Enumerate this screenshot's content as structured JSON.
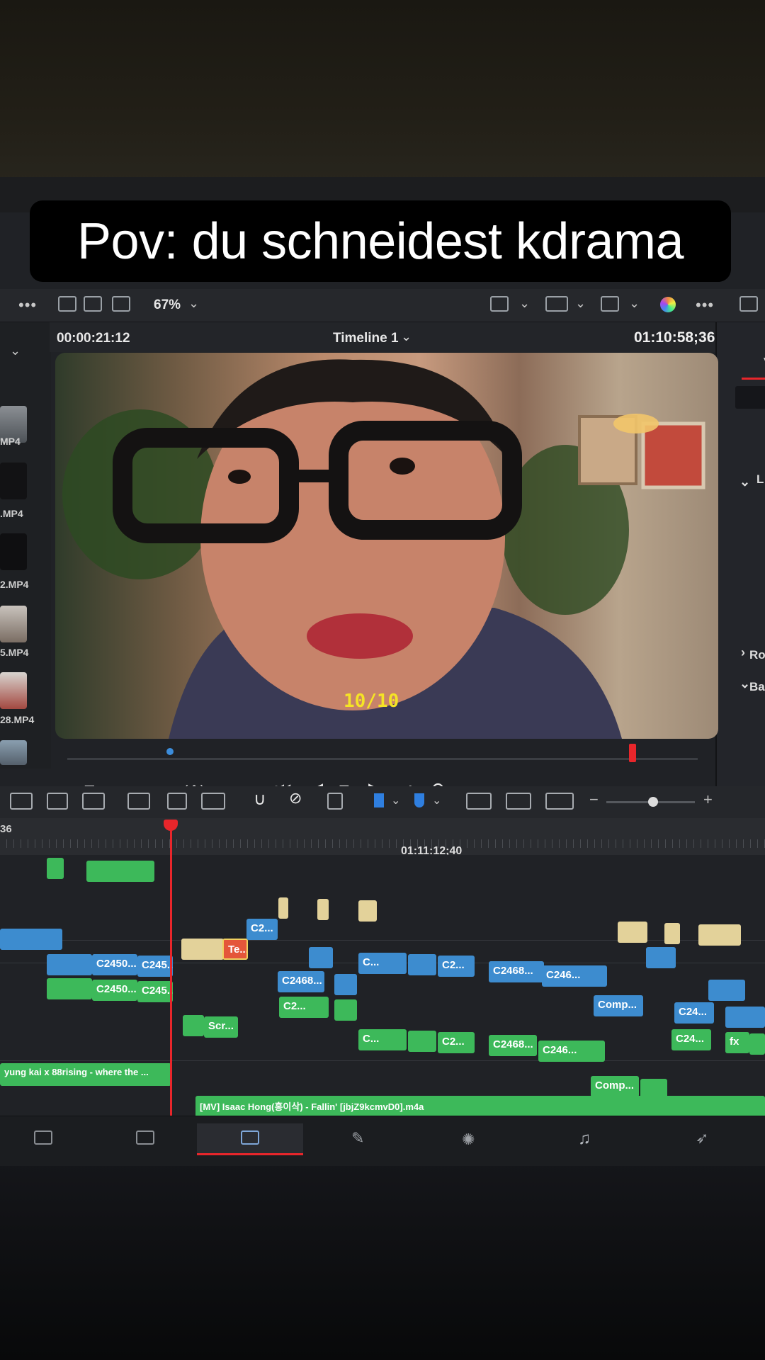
{
  "caption": "Pov: du schneidest kdrama",
  "toolbar": {
    "zoom_label": "67%",
    "icons": [
      "viewer-layout-icon",
      "clip-view-icon",
      "strip-icon",
      "safe-area-icon",
      "hq-icon",
      "transform-icon",
      "color-wheel-icon",
      "more-icon",
      "image-icon"
    ]
  },
  "viewer": {
    "timecode_source": "00:00:21:12",
    "timeline_name": "Timeline 1",
    "timecode_record": "01:10:58;36",
    "subtitle_text": "10/10"
  },
  "media_pool": {
    "items": [
      {
        "label": "MP4"
      },
      {
        "label": ".MP4"
      },
      {
        "label": "2.MP4"
      },
      {
        "label": "5.MP4"
      },
      {
        "label": "28.MP4"
      }
    ]
  },
  "inspector": {
    "labels": [
      "V",
      "L",
      "Ro",
      "Ba"
    ]
  },
  "transport": {
    "buttons": [
      "skip-start",
      "step-back",
      "stop",
      "play",
      "skip-end",
      "loop"
    ]
  },
  "timeline": {
    "ruler_left_tc": "36",
    "ruler_tc": "01:11:12;40",
    "clips": {
      "c2_a": "C2...",
      "te": "Te...",
      "c2450_blue": "C2450...",
      "c245_blue": "C245...",
      "c_blue": "C...",
      "c2_blue": "C2...",
      "c2468_blue": "C2468...",
      "c246_blue": "C246...",
      "c2468_b": "C2468...",
      "comp1": "Comp...",
      "c24_a": "C24...",
      "c2450_green": "C2450...",
      "c245_green": "C245...",
      "c2_green": "C2...",
      "scr": "Scr...",
      "c_green": "C...",
      "c2_green2": "C2...",
      "c2468_green": "C2468...",
      "c246_green": "C246...",
      "c24_green": "C24...",
      "fx": "fx",
      "comp2": "Comp...",
      "audio1": "yung kai x 88rising - where the ...",
      "audio2": "[MV] Isaac Hong(홍이삭) - Fallin' [jbjZ9kcmvD0].m4a"
    }
  },
  "pages": [
    "media",
    "cut",
    "edit",
    "fusion",
    "color",
    "fairlight",
    "deliver"
  ]
}
